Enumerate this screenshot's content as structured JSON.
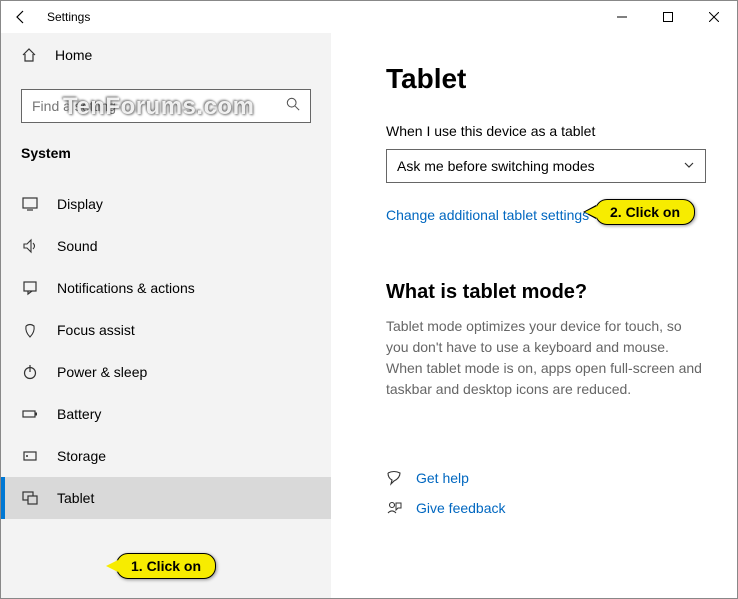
{
  "window": {
    "title": "Settings"
  },
  "sidebar": {
    "home_label": "Home",
    "search_placeholder": "Find a setting",
    "section_header": "System",
    "items": [
      {
        "label": "Display"
      },
      {
        "label": "Sound"
      },
      {
        "label": "Notifications & actions"
      },
      {
        "label": "Focus assist"
      },
      {
        "label": "Power & sleep"
      },
      {
        "label": "Battery"
      },
      {
        "label": "Storage"
      },
      {
        "label": "Tablet"
      }
    ]
  },
  "content": {
    "page_title": "Tablet",
    "field_label": "When I use this device as a tablet",
    "dropdown_value": "Ask me before switching modes",
    "link_label": "Change additional tablet settings",
    "section_title": "What is tablet mode?",
    "body_text": "Tablet mode optimizes your device for touch, so you don't have to use a keyboard and mouse. When tablet mode is on, apps open full-screen and taskbar and desktop icons are reduced.",
    "get_help_label": "Get help",
    "give_feedback_label": "Give feedback"
  },
  "annotations": {
    "callout1": "1. Click on",
    "callout2": "2. Click on"
  },
  "watermark": "TenForums.com"
}
